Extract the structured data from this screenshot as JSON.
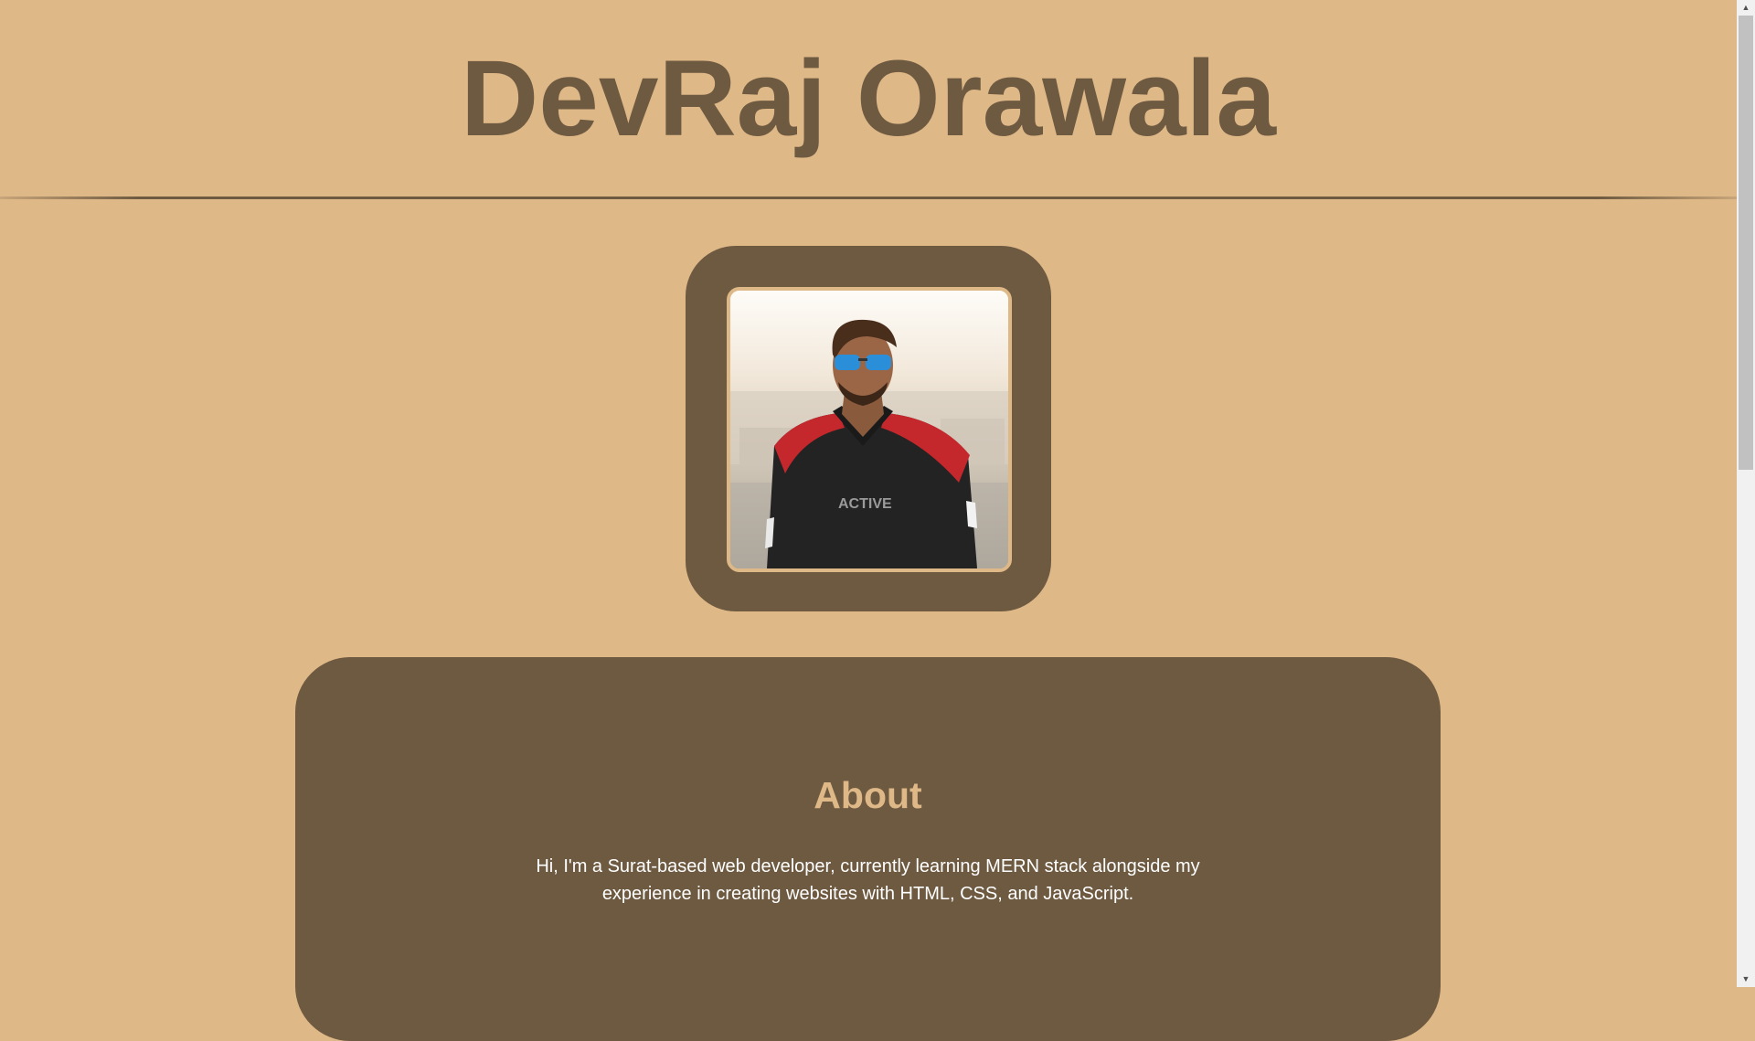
{
  "header": {
    "title": "DevRaj Orawala"
  },
  "profile": {
    "photo_alt": "DevRaj Orawala"
  },
  "about": {
    "heading": "About",
    "text": "Hi, I'm a Surat-based web developer, currently learning MERN stack alongside my experience in creating websites with HTML, CSS, and JavaScript."
  },
  "scrollbar": {
    "up_icon": "▲",
    "down_icon": "▼"
  },
  "colors": {
    "background": "#dfb888",
    "accent_dark": "#6e5a41",
    "text_light": "#ffffff"
  }
}
